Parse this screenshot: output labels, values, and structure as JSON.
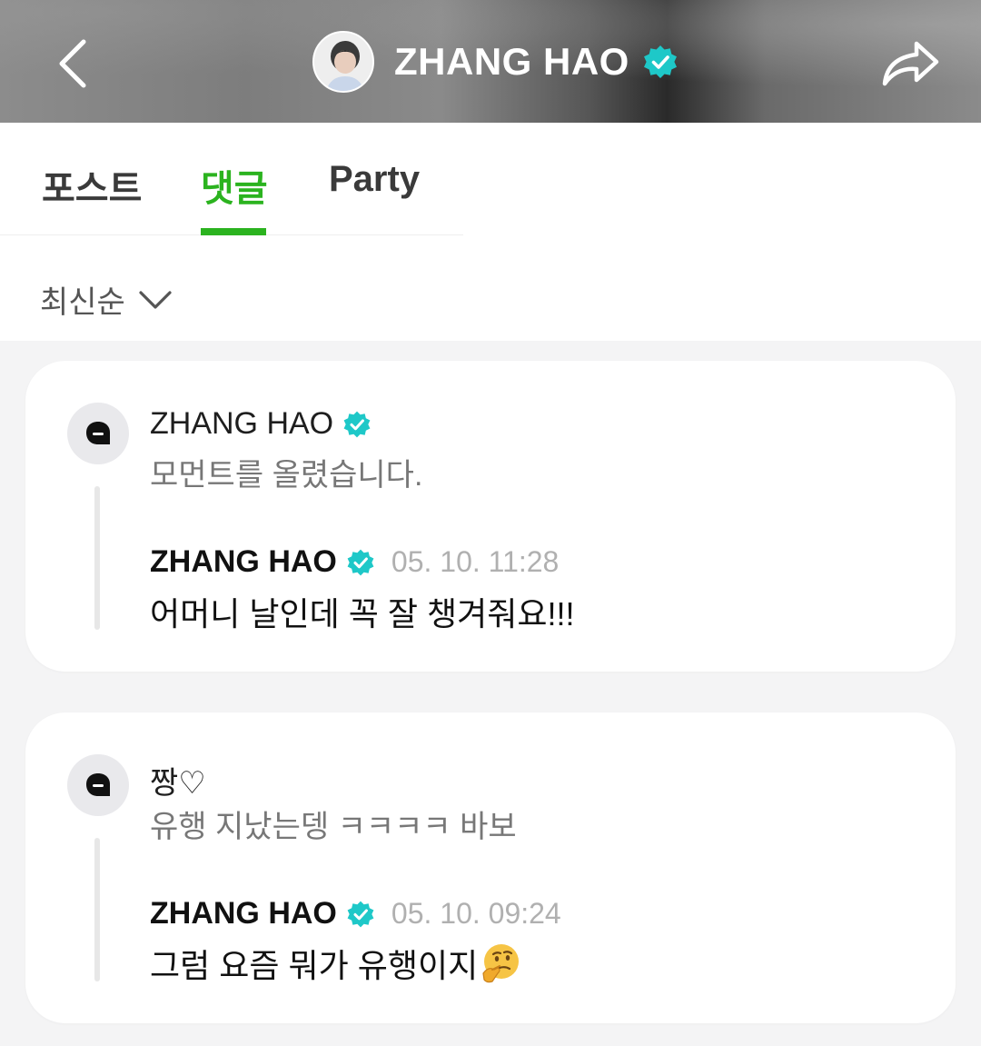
{
  "header": {
    "title": "ZHANG HAO",
    "back_icon": "chevron-left-icon",
    "share_icon": "share-arrow-icon",
    "verified_color": "#1ec8c8"
  },
  "tabs": [
    {
      "label": "포스트",
      "active": false
    },
    {
      "label": "댓글",
      "active": true
    },
    {
      "label": "Party",
      "active": false
    }
  ],
  "accent_color": "#2bb31f",
  "sort": {
    "label": "최신순",
    "icon": "chevron-down-icon"
  },
  "comments": [
    {
      "author": "ZHANG HAO",
      "author_verified": true,
      "text": "모먼트를 올렸습니다.",
      "reply": {
        "author": "ZHANG HAO",
        "time": "05. 10. 11:28",
        "text": "어머니 날인데 꼭 잘 챙겨줘요!!!"
      }
    },
    {
      "author": "짱♡",
      "author_verified": false,
      "text": "유행 지났는뎅 ㅋㅋㅋㅋ 바보",
      "reply": {
        "author": "ZHANG HAO",
        "time": "05. 10. 09:24",
        "text": "그럼 요즘 뭐가 유행이지",
        "emoji": "thinking-face-icon"
      }
    }
  ]
}
